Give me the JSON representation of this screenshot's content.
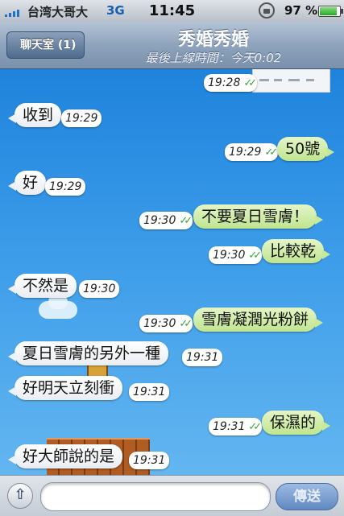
{
  "status_bar": {
    "carrier": "台湾大哥大",
    "network": "3G",
    "time": "11:45",
    "battery": "97 %",
    "battery_level": 0.97
  },
  "header": {
    "back_label": "聊天室 (1)",
    "title": "秀婚秀婚",
    "subtitle": "最後上線時間：今天0:02"
  },
  "messages": [
    {
      "side": "out",
      "text": "",
      "time": "19:28",
      "read": true
    },
    {
      "side": "in",
      "text": "收到",
      "time": "19:29"
    },
    {
      "side": "out",
      "text": "50號",
      "time": "19:29",
      "read": true
    },
    {
      "side": "in",
      "text": "好",
      "time": "19:29"
    },
    {
      "side": "out",
      "text": "不要夏日雪膚！",
      "time": "19:30",
      "read": true
    },
    {
      "side": "out",
      "text": "比較乾",
      "time": "19:30",
      "read": true
    },
    {
      "side": "in",
      "text": "不然是",
      "time": "19:30"
    },
    {
      "side": "out",
      "text": "雪膚凝潤光粉餅",
      "time": "19:30",
      "read": true
    },
    {
      "side": "in",
      "text": "夏日雪膚的另外一種",
      "time": "19:31"
    },
    {
      "side": "in",
      "text": "好明天立刻衝",
      "time": "19:31"
    },
    {
      "side": "out",
      "text": "保濕的",
      "time": "19:31",
      "read": true
    },
    {
      "side": "in",
      "text": "好大師說的是",
      "time": "19:31"
    }
  ],
  "input": {
    "placeholder": "",
    "send_label": "傳送"
  },
  "icons": {
    "back": "back-arrow-icon",
    "attach": "up-arrow-icon",
    "read": "double-check-icon",
    "lock": "rotation-lock-icon"
  },
  "colors": {
    "incoming_bubble": "#ffffff",
    "outgoing_bubble": "#c6e99c",
    "read_check": "#3aa63a",
    "chat_background": "#2f90e2"
  }
}
